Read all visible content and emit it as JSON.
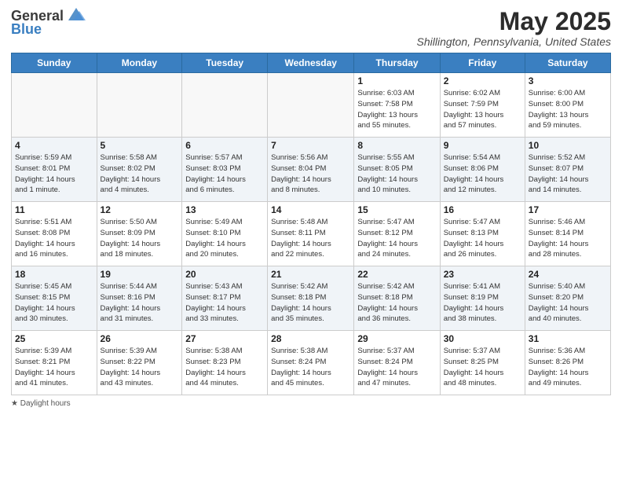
{
  "header": {
    "logo_line1": "General",
    "logo_line2": "Blue",
    "month_title": "May 2025",
    "location": "Shillington, Pennsylvania, United States"
  },
  "weekdays": [
    "Sunday",
    "Monday",
    "Tuesday",
    "Wednesday",
    "Thursday",
    "Friday",
    "Saturday"
  ],
  "legend": "Daylight hours",
  "weeks": [
    [
      {
        "day": "",
        "info": ""
      },
      {
        "day": "",
        "info": ""
      },
      {
        "day": "",
        "info": ""
      },
      {
        "day": "",
        "info": ""
      },
      {
        "day": "1",
        "info": "Sunrise: 6:03 AM\nSunset: 7:58 PM\nDaylight: 13 hours\nand 55 minutes."
      },
      {
        "day": "2",
        "info": "Sunrise: 6:02 AM\nSunset: 7:59 PM\nDaylight: 13 hours\nand 57 minutes."
      },
      {
        "day": "3",
        "info": "Sunrise: 6:00 AM\nSunset: 8:00 PM\nDaylight: 13 hours\nand 59 minutes."
      }
    ],
    [
      {
        "day": "4",
        "info": "Sunrise: 5:59 AM\nSunset: 8:01 PM\nDaylight: 14 hours\nand 1 minute."
      },
      {
        "day": "5",
        "info": "Sunrise: 5:58 AM\nSunset: 8:02 PM\nDaylight: 14 hours\nand 4 minutes."
      },
      {
        "day": "6",
        "info": "Sunrise: 5:57 AM\nSunset: 8:03 PM\nDaylight: 14 hours\nand 6 minutes."
      },
      {
        "day": "7",
        "info": "Sunrise: 5:56 AM\nSunset: 8:04 PM\nDaylight: 14 hours\nand 8 minutes."
      },
      {
        "day": "8",
        "info": "Sunrise: 5:55 AM\nSunset: 8:05 PM\nDaylight: 14 hours\nand 10 minutes."
      },
      {
        "day": "9",
        "info": "Sunrise: 5:54 AM\nSunset: 8:06 PM\nDaylight: 14 hours\nand 12 minutes."
      },
      {
        "day": "10",
        "info": "Sunrise: 5:52 AM\nSunset: 8:07 PM\nDaylight: 14 hours\nand 14 minutes."
      }
    ],
    [
      {
        "day": "11",
        "info": "Sunrise: 5:51 AM\nSunset: 8:08 PM\nDaylight: 14 hours\nand 16 minutes."
      },
      {
        "day": "12",
        "info": "Sunrise: 5:50 AM\nSunset: 8:09 PM\nDaylight: 14 hours\nand 18 minutes."
      },
      {
        "day": "13",
        "info": "Sunrise: 5:49 AM\nSunset: 8:10 PM\nDaylight: 14 hours\nand 20 minutes."
      },
      {
        "day": "14",
        "info": "Sunrise: 5:48 AM\nSunset: 8:11 PM\nDaylight: 14 hours\nand 22 minutes."
      },
      {
        "day": "15",
        "info": "Sunrise: 5:47 AM\nSunset: 8:12 PM\nDaylight: 14 hours\nand 24 minutes."
      },
      {
        "day": "16",
        "info": "Sunrise: 5:47 AM\nSunset: 8:13 PM\nDaylight: 14 hours\nand 26 minutes."
      },
      {
        "day": "17",
        "info": "Sunrise: 5:46 AM\nSunset: 8:14 PM\nDaylight: 14 hours\nand 28 minutes."
      }
    ],
    [
      {
        "day": "18",
        "info": "Sunrise: 5:45 AM\nSunset: 8:15 PM\nDaylight: 14 hours\nand 30 minutes."
      },
      {
        "day": "19",
        "info": "Sunrise: 5:44 AM\nSunset: 8:16 PM\nDaylight: 14 hours\nand 31 minutes."
      },
      {
        "day": "20",
        "info": "Sunrise: 5:43 AM\nSunset: 8:17 PM\nDaylight: 14 hours\nand 33 minutes."
      },
      {
        "day": "21",
        "info": "Sunrise: 5:42 AM\nSunset: 8:18 PM\nDaylight: 14 hours\nand 35 minutes."
      },
      {
        "day": "22",
        "info": "Sunrise: 5:42 AM\nSunset: 8:18 PM\nDaylight: 14 hours\nand 36 minutes."
      },
      {
        "day": "23",
        "info": "Sunrise: 5:41 AM\nSunset: 8:19 PM\nDaylight: 14 hours\nand 38 minutes."
      },
      {
        "day": "24",
        "info": "Sunrise: 5:40 AM\nSunset: 8:20 PM\nDaylight: 14 hours\nand 40 minutes."
      }
    ],
    [
      {
        "day": "25",
        "info": "Sunrise: 5:39 AM\nSunset: 8:21 PM\nDaylight: 14 hours\nand 41 minutes."
      },
      {
        "day": "26",
        "info": "Sunrise: 5:39 AM\nSunset: 8:22 PM\nDaylight: 14 hours\nand 43 minutes."
      },
      {
        "day": "27",
        "info": "Sunrise: 5:38 AM\nSunset: 8:23 PM\nDaylight: 14 hours\nand 44 minutes."
      },
      {
        "day": "28",
        "info": "Sunrise: 5:38 AM\nSunset: 8:24 PM\nDaylight: 14 hours\nand 45 minutes."
      },
      {
        "day": "29",
        "info": "Sunrise: 5:37 AM\nSunset: 8:24 PM\nDaylight: 14 hours\nand 47 minutes."
      },
      {
        "day": "30",
        "info": "Sunrise: 5:37 AM\nSunset: 8:25 PM\nDaylight: 14 hours\nand 48 minutes."
      },
      {
        "day": "31",
        "info": "Sunrise: 5:36 AM\nSunset: 8:26 PM\nDaylight: 14 hours\nand 49 minutes."
      }
    ]
  ]
}
